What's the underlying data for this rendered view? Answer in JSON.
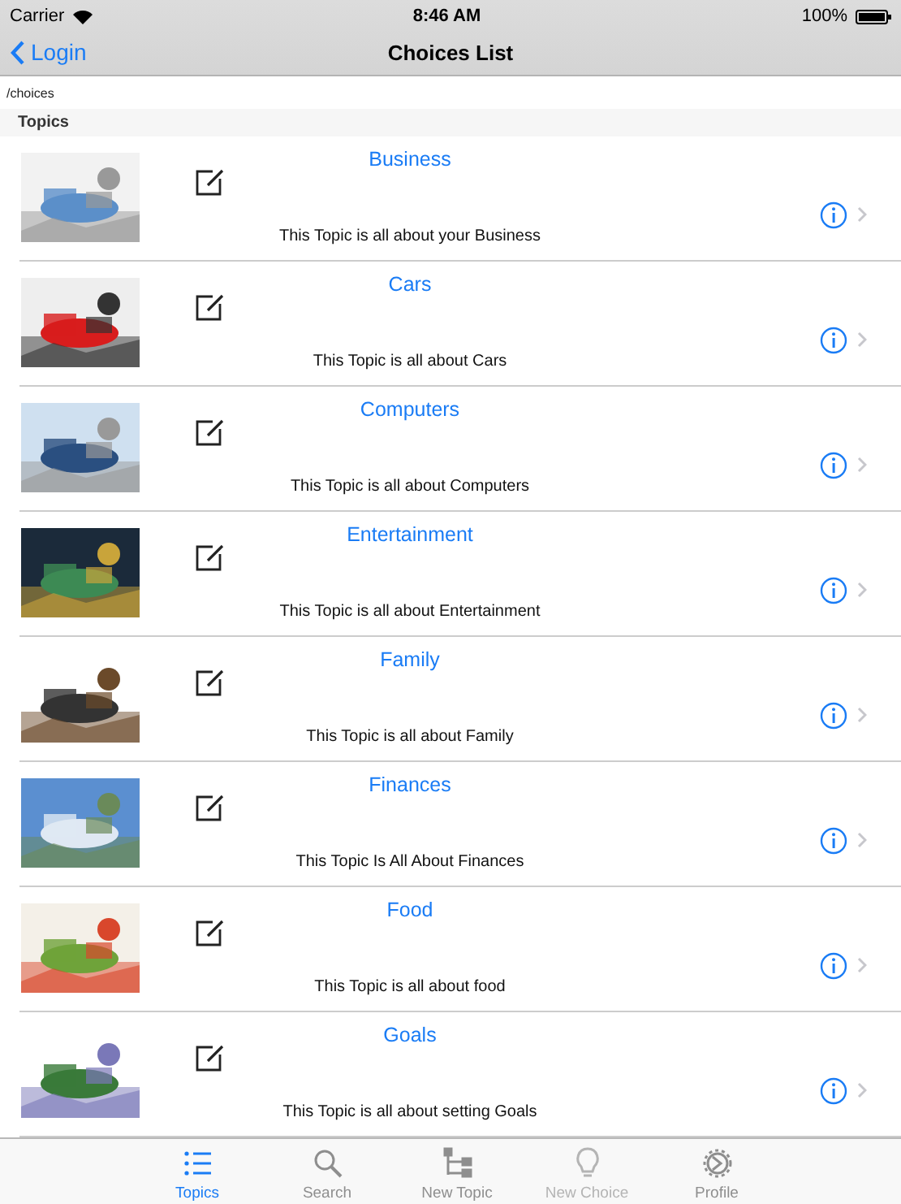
{
  "status_bar": {
    "carrier": "Carrier",
    "time": "8:46 AM",
    "battery": "100%"
  },
  "nav_bar": {
    "back": "Login",
    "title": "Choices List"
  },
  "path": "/choices",
  "section": "Topics",
  "topics": [
    {
      "title": "Business",
      "description": "This Topic is all about your Business"
    },
    {
      "title": "Cars",
      "description": "This Topic is all about Cars"
    },
    {
      "title": "Computers",
      "description": "This Topic is all about Computers"
    },
    {
      "title": "Entertainment",
      "description": "This Topic is all about Entertainment"
    },
    {
      "title": "Family",
      "description": "This Topic is all about Family"
    },
    {
      "title": "Finances",
      "description": "This Topic Is All About Finances"
    },
    {
      "title": "Food",
      "description": "This Topic is all about food"
    },
    {
      "title": "Goals",
      "description": "This Topic is all about setting Goals"
    }
  ],
  "tab_bar": [
    {
      "label": "Topics",
      "kind": "list",
      "selected": true,
      "disabled": false
    },
    {
      "label": "Search",
      "kind": "search",
      "selected": false,
      "disabled": false
    },
    {
      "label": "New Topic",
      "kind": "tree",
      "selected": false,
      "disabled": false
    },
    {
      "label": "New Choice",
      "kind": "bulb",
      "selected": false,
      "disabled": true
    },
    {
      "label": "Profile",
      "kind": "gear",
      "selected": false,
      "disabled": false
    }
  ]
}
